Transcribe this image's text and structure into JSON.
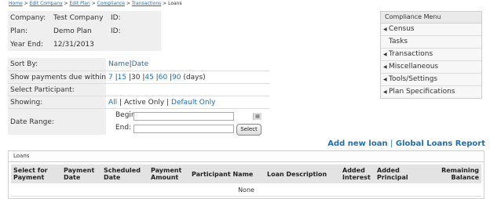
{
  "breadcrumb": {
    "items": [
      "Home",
      "Edit Company",
      "Edit Plan",
      "Compliance",
      "Transactions"
    ],
    "current": "Loans",
    "separator": ">"
  },
  "info": {
    "company_label": "Company:",
    "company_value": "Test Company",
    "company_id_label": "ID:",
    "plan_label": "Plan:",
    "plan_value": "Demo Plan",
    "plan_id_label": "ID:",
    "year_end_label": "Year End:",
    "year_end_value": "12/31/2013"
  },
  "filters": {
    "sort_by_label": "Sort By:",
    "sort_name": "Name",
    "sort_date": "Date",
    "due_label": "Show payments due within:",
    "due_options": [
      "7",
      "15",
      "30",
      "45",
      "60",
      "90"
    ],
    "due_unit": "(days)",
    "participant_label": "Select Participant:",
    "showing_label": "Showing:",
    "showing_all": "All",
    "showing_active": "Active Only",
    "showing_default": "Default Only",
    "date_range_label": "Date Range:",
    "begin_label": "Begin:",
    "end_label": "End:",
    "select_button": "Select"
  },
  "menu": {
    "title": "Compliance Menu",
    "items": [
      "Census",
      "Tasks",
      "Transactions",
      "Miscellaneous",
      "Tools/Settings",
      "Plan Specifications"
    ]
  },
  "actions": {
    "add_new_loan": "Add new loan",
    "global_loans_report": "Global Loans Report"
  },
  "loans": {
    "title": "Loans",
    "columns": [
      "Select for Payment",
      "Payment Date",
      "Scheduled Date",
      "Payment Amount",
      "Participant Name",
      "Loan Description",
      "Added Interest",
      "Added Principal",
      "Remaining Balance"
    ],
    "empty_text": "None"
  }
}
